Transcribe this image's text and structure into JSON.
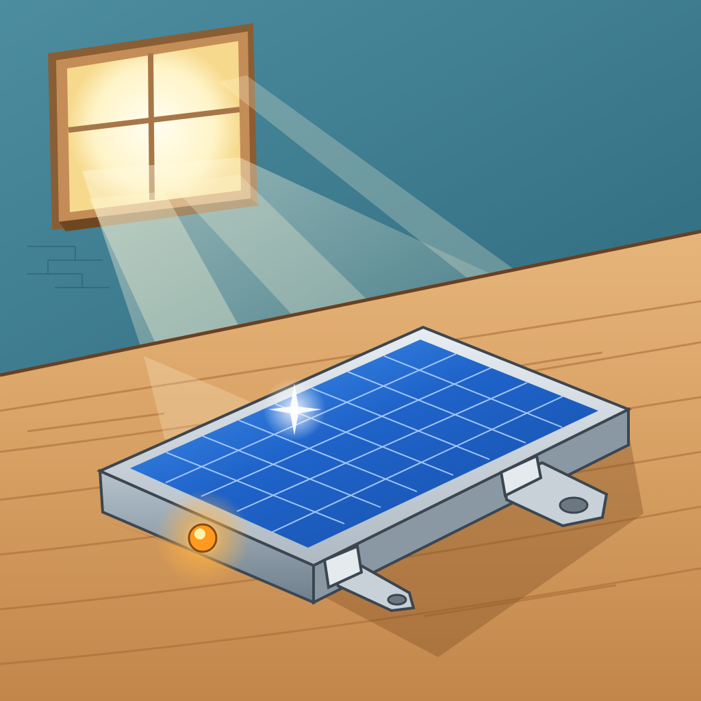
{
  "scene": {
    "colors": {
      "wall_light": "#6fa6b6",
      "wall_dark": "#2f6a7e",
      "wood_light": "#e7b97f",
      "wood_mid": "#c98e52",
      "wood_dark": "#9a5e2c",
      "frame": "#a77648",
      "panel_blue": "#1c5fc2",
      "panel_blue_light": "#3a8cf0",
      "casing_metal": "#8e9ca7",
      "casing_light": "#d6dee5",
      "led_glow": "#ffb347"
    },
    "elements": [
      "back-wall",
      "window",
      "sunlight-beams",
      "wooden-table",
      "solar-panel-device",
      "solar-cell-grid",
      "metal-casing",
      "indicator-light",
      "connector-tab-right",
      "connector-tab-front"
    ]
  }
}
